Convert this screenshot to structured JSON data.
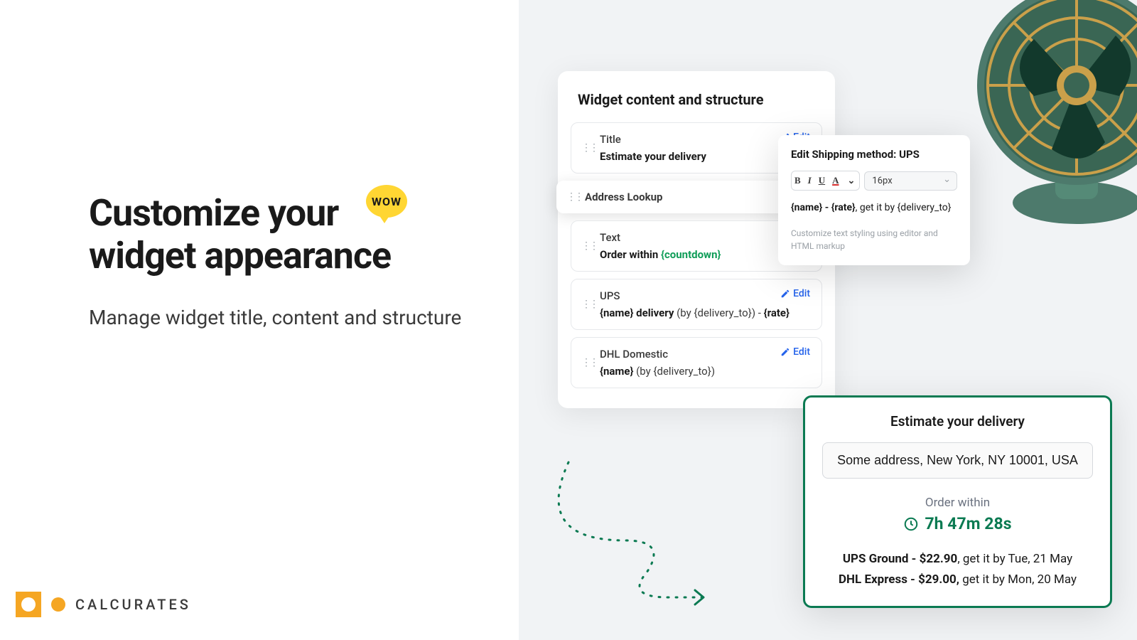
{
  "wow": "WOW",
  "headline_l1": "Customize your",
  "headline_l2": "widget appearance",
  "subheadline": "Manage widget title, content and structure",
  "logo_text": "CALCURATES",
  "settings": {
    "title": "Widget content and structure",
    "edit_label": "Edit",
    "items": [
      {
        "label": "Title",
        "value": "Estimate your delivery"
      },
      {
        "label": "Address Lookup"
      },
      {
        "label": "Text",
        "pre": "Order within ",
        "green": "{countdown}"
      },
      {
        "label": "UPS",
        "bold1": "{name} delivery",
        "light": " (by {delivery_to}) - ",
        "bold2": "{rate}"
      },
      {
        "label": "DHL Domestic",
        "bold1": "{name}",
        "light": " (by {delivery_to})"
      }
    ]
  },
  "editor": {
    "title": "Edit Shipping method: UPS",
    "size": "16px",
    "content_bold": "{name} - {rate}",
    "content_rest": ", get it by {delivery_to}",
    "hint": "Customize text styling using editor and HTML markup"
  },
  "preview": {
    "title": "Estimate your delivery",
    "address": "Some address, New York, NY 10001, USA",
    "order_within": "Order within",
    "countdown": "7h 47m 28s",
    "line1_bold": "UPS Ground - $22.90",
    "line1_rest": ", get it by Tue, 21 May",
    "line2_bold": "DHL Express - $29.00,",
    "line2_rest": " get it by Mon, 20 May"
  }
}
